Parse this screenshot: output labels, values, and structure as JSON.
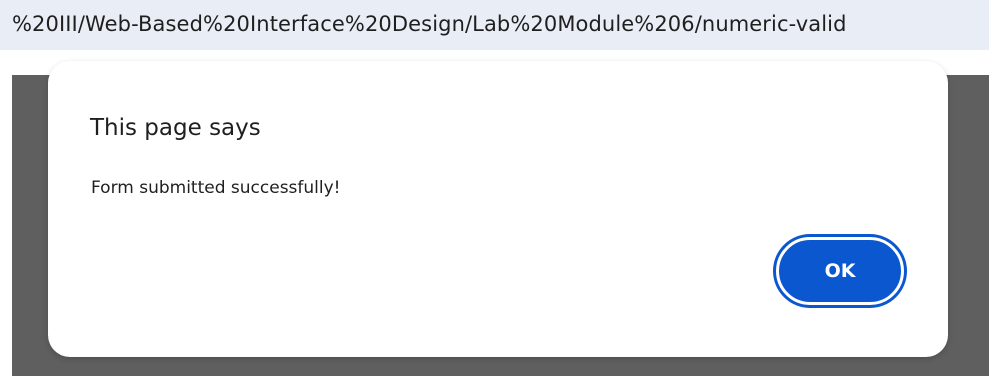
{
  "address_bar": {
    "url_text": "%20III/Web-Based%20Interface%20Design/Lab%20Module%206/numeric-valid"
  },
  "dialog": {
    "title": "This page says",
    "message": "Form submitted successfully!",
    "ok_label": "OK"
  },
  "colors": {
    "accent": "#0b57d0",
    "overlay": "#5f5f5f",
    "url_bar_bg": "#e9eef6"
  }
}
